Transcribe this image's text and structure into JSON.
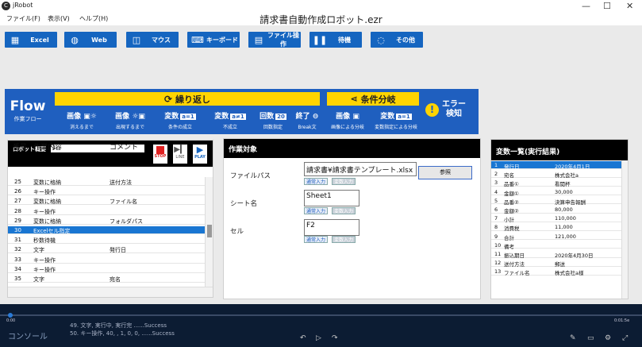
{
  "window": {
    "app_name": "jRobot",
    "title": "請求書自動作成ロボット.ezr",
    "icon_letter": "C"
  },
  "menu": [
    "ファイル(F)",
    "表示(V)",
    "ヘルプ(H)"
  ],
  "categories": [
    {
      "label": "Excel",
      "icon": "excel-icon"
    },
    {
      "label": "Web",
      "icon": "globe-icon"
    },
    {
      "label": "マウス",
      "icon": "mouse-icon"
    },
    {
      "label": "キーボード",
      "icon": "keyboard-icon"
    },
    {
      "label": "ファイル操作",
      "icon": "file-icon"
    },
    {
      "label": "待機",
      "icon": "pause-icon"
    },
    {
      "label": "その他",
      "icon": "bulb-icon"
    }
  ],
  "flow": {
    "title": "Flow",
    "subtitle": "作業フロー",
    "loop_header": "繰り返し",
    "branch_header": "条件分岐",
    "items": [
      {
        "title": "画像",
        "sub": "消えるまで"
      },
      {
        "title": "画像",
        "sub": "出現するまで"
      },
      {
        "title": "変数",
        "tag": "a=1",
        "sub": "条件の成立"
      },
      {
        "title": "変数",
        "tag": "a≠1",
        "sub": "不成立"
      },
      {
        "title": "回数",
        "tag": "20",
        "sub": "回数指定"
      },
      {
        "title": "終了",
        "sub": "Break文"
      },
      {
        "title": "画像",
        "sub": "画像による分岐"
      },
      {
        "title": "変数",
        "tag": "a=1",
        "sub": "変数指定による分岐"
      }
    ],
    "error": {
      "line1": "エラー",
      "line2": "検知"
    }
  },
  "robot": {
    "label": "ロボット概要",
    "value": "1",
    "stop": "STOP",
    "line": "LINE",
    "play": "PLAY",
    "columns": [
      "番号",
      "作業内容",
      "コメント"
    ],
    "rows": [
      {
        "no": "25",
        "task": "変数に格納",
        "comment": "送付方法"
      },
      {
        "no": "26",
        "task": "キー操作",
        "comment": ""
      },
      {
        "no": "27",
        "task": "変数に格納",
        "comment": "ファイル名"
      },
      {
        "no": "28",
        "task": "キー操作",
        "comment": ""
      },
      {
        "no": "29",
        "task": "変数に格納",
        "comment": "フォルダパス"
      },
      {
        "no": "30",
        "task": "Excelセル指定",
        "comment": ""
      },
      {
        "no": "31",
        "task": "秒数待機",
        "comment": ""
      },
      {
        "no": "32",
        "task": "文字",
        "comment": "発行日"
      },
      {
        "no": "33",
        "task": "キー操作",
        "comment": ""
      },
      {
        "no": "34",
        "task": "キー操作",
        "comment": ""
      },
      {
        "no": "35",
        "task": "文字",
        "comment": "宛名"
      }
    ],
    "selected_no": "30"
  },
  "target": {
    "header": "作業対象",
    "fields": [
      {
        "label": "ファイルパス",
        "value": "請求書¥請求書テンプレート.xlsx"
      },
      {
        "label": "シート名",
        "value": "Sheet1"
      },
      {
        "label": "セル",
        "value": "F2"
      }
    ],
    "browse": "参照",
    "normal_input": "通常入力",
    "var_input": "変数入力"
  },
  "variables": {
    "header": "変数一覧(実行結果)",
    "rows": [
      {
        "no": "1",
        "name": "発行日",
        "value": "2020年4月1日"
      },
      {
        "no": "2",
        "name": "宛名",
        "value": "株式会社a"
      },
      {
        "no": "3",
        "name": "品番①",
        "value": "看閲杯"
      },
      {
        "no": "4",
        "name": "金額①",
        "value": "30,000"
      },
      {
        "no": "5",
        "name": "品番②",
        "value": "決算申告報酬"
      },
      {
        "no": "6",
        "name": "金額②",
        "value": "80,000"
      },
      {
        "no": "7",
        "name": "小計",
        "value": "110,000"
      },
      {
        "no": "8",
        "name": "消費税",
        "value": "11,000"
      },
      {
        "no": "9",
        "name": "合計",
        "value": "121,000"
      },
      {
        "no": "10",
        "name": "備考",
        "value": ""
      },
      {
        "no": "11",
        "name": "振込期日",
        "value": "2020年4月30日"
      },
      {
        "no": "12",
        "name": "送付方法",
        "value": "郵送"
      },
      {
        "no": "13",
        "name": "ファイル名",
        "value": "株式会社a様"
      }
    ],
    "selected_no": "1"
  },
  "console": {
    "label": "コンソール",
    "lines": [
      "49. 文字, 実行中, 実行完 ......Success",
      "50. キー操作, 40, , 1, 0, 0, ......Success"
    ],
    "time_left": "0:00",
    "time_right": "0:01:5e"
  }
}
